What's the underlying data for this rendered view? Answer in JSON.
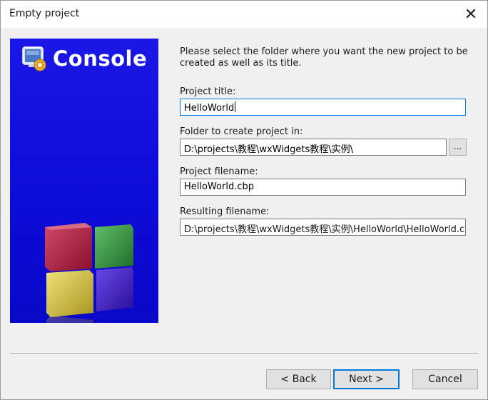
{
  "window": {
    "title": "Empty project",
    "close_glyph": "✕"
  },
  "banner": {
    "title": "Console",
    "icon": "console-app-icon",
    "cube_colors": [
      "#a3153a",
      "#2f8a3a",
      "#c8b92c",
      "#3a16b8"
    ]
  },
  "intro": "Please select the folder where you want the new project to be created as well as its title.",
  "fields": {
    "project_title": {
      "label": "Project title:",
      "value": "HelloWorld"
    },
    "folder": {
      "label": "Folder to create project in:",
      "value": "D:\\projects\\教程\\wxWidgets教程\\实例\\"
    },
    "project_filename": {
      "label": "Project filename:",
      "value": "HelloWorld.cbp"
    },
    "resulting_filename": {
      "label": "Resulting filename:",
      "value": "D:\\projects\\教程\\wxWidgets教程\\实例\\HelloWorld\\HelloWorld.cbp"
    }
  },
  "browse_label": "...",
  "buttons": {
    "back": "< Back",
    "next": "Next >",
    "cancel": "Cancel"
  },
  "colors": {
    "banner_blue": "#1212e0",
    "focus_blue": "#0078d7"
  }
}
